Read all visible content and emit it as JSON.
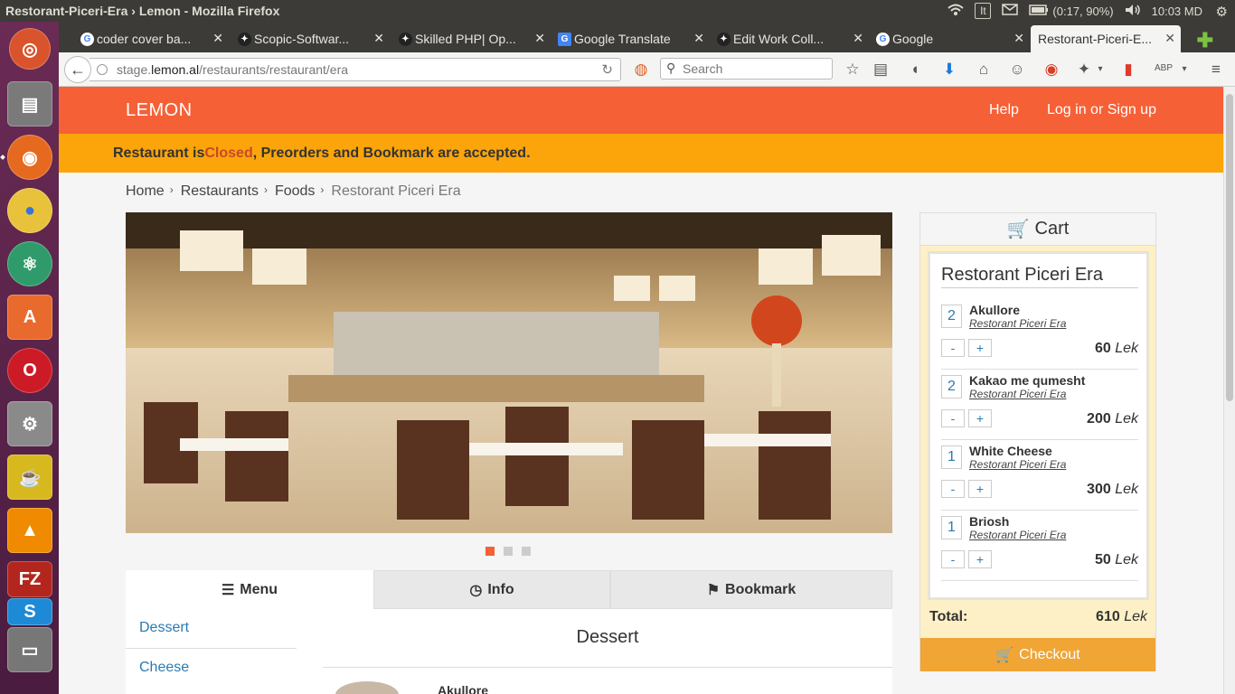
{
  "os_panel": {
    "window_title": "Restorant-Piceri-Era › Lemon - Mozilla Firefox",
    "keyboard": "It",
    "battery": "(0:17, 90%)",
    "clock": "10:03 MD"
  },
  "browser": {
    "tabs": [
      {
        "label": "coder cover ba..."
      },
      {
        "label": "Scopic-Softwar..."
      },
      {
        "label": "Skilled PHP| Op..."
      },
      {
        "label": "Google Translate"
      },
      {
        "label": "Edit Work Coll..."
      },
      {
        "label": "Google"
      },
      {
        "label": "Restorant-Piceri-E..."
      }
    ],
    "url_prefix": "stage.",
    "url_host": "lemon.al",
    "url_path": "/restaurants/restaurant/era",
    "search_placeholder": "Search"
  },
  "site": {
    "brand": "LEMON",
    "help": "Help",
    "login": "Log in or Sign up",
    "notice_prefix": "Restaurant is ",
    "notice_closed": "Closed",
    "notice_suffix": ", Preorders and Bookmark are accepted.",
    "breadcrumb": [
      "Home",
      "Restaurants",
      "Foods",
      "Restorant Piceri Era"
    ],
    "tabs": [
      "Menu",
      "Info",
      "Bookmark"
    ],
    "categories": [
      "Dessert",
      "Cheese"
    ],
    "section_title": "Dessert",
    "first_item": "Akullore"
  },
  "cart": {
    "title": "Cart",
    "restaurant": "Restorant Piceri Era",
    "items": [
      {
        "qty": "2",
        "name": "Akullore",
        "restaurant": "Restorant Piceri Era",
        "price": "60",
        "currency": "Lek"
      },
      {
        "qty": "2",
        "name": "Kakao me qumesht",
        "restaurant": "Restorant Piceri Era",
        "price": "200",
        "currency": "Lek"
      },
      {
        "qty": "1",
        "name": "White Cheese",
        "restaurant": "Restorant Piceri Era",
        "price": "300",
        "currency": "Lek"
      },
      {
        "qty": "1",
        "name": "Briosh",
        "restaurant": "Restorant Piceri Era",
        "price": "50",
        "currency": "Lek"
      }
    ],
    "minus": "-",
    "plus": "+",
    "total_label": "Total:",
    "total_value": "610",
    "total_currency": "Lek",
    "checkout": "Checkout"
  },
  "colors": {
    "header_orange": "#f66037",
    "notice_yellow": "#fca50a",
    "checkout_orange": "#f0a535",
    "link_blue": "#2a7ab0"
  }
}
